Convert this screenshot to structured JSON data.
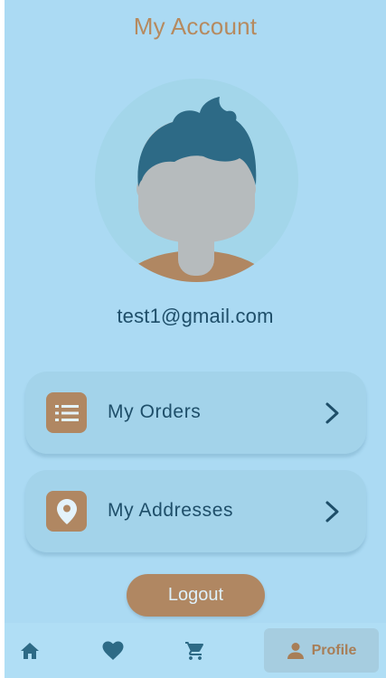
{
  "header": {
    "title": "My Account"
  },
  "profile": {
    "avatar_icon": "user-avatar-icon",
    "email": "test1@gmail.com"
  },
  "menu": {
    "items": [
      {
        "label": "My Orders",
        "icon": "list-icon"
      },
      {
        "label": "My Addresses",
        "icon": "location-pin-icon"
      }
    ]
  },
  "actions": {
    "logout_label": "Logout"
  },
  "bottom_nav": {
    "items": [
      {
        "icon": "home-icon",
        "label": "",
        "active": false
      },
      {
        "icon": "heart-icon",
        "label": "",
        "active": false
      },
      {
        "icon": "cart-icon",
        "label": "",
        "active": false
      },
      {
        "icon": "person-icon",
        "label": "Profile",
        "active": true
      }
    ]
  },
  "colors": {
    "background": "#abdaf3",
    "accent": "#b08762",
    "text_dark": "#1e4e69",
    "card": "#a3d3ea",
    "nav_bar": "#b0def5"
  }
}
